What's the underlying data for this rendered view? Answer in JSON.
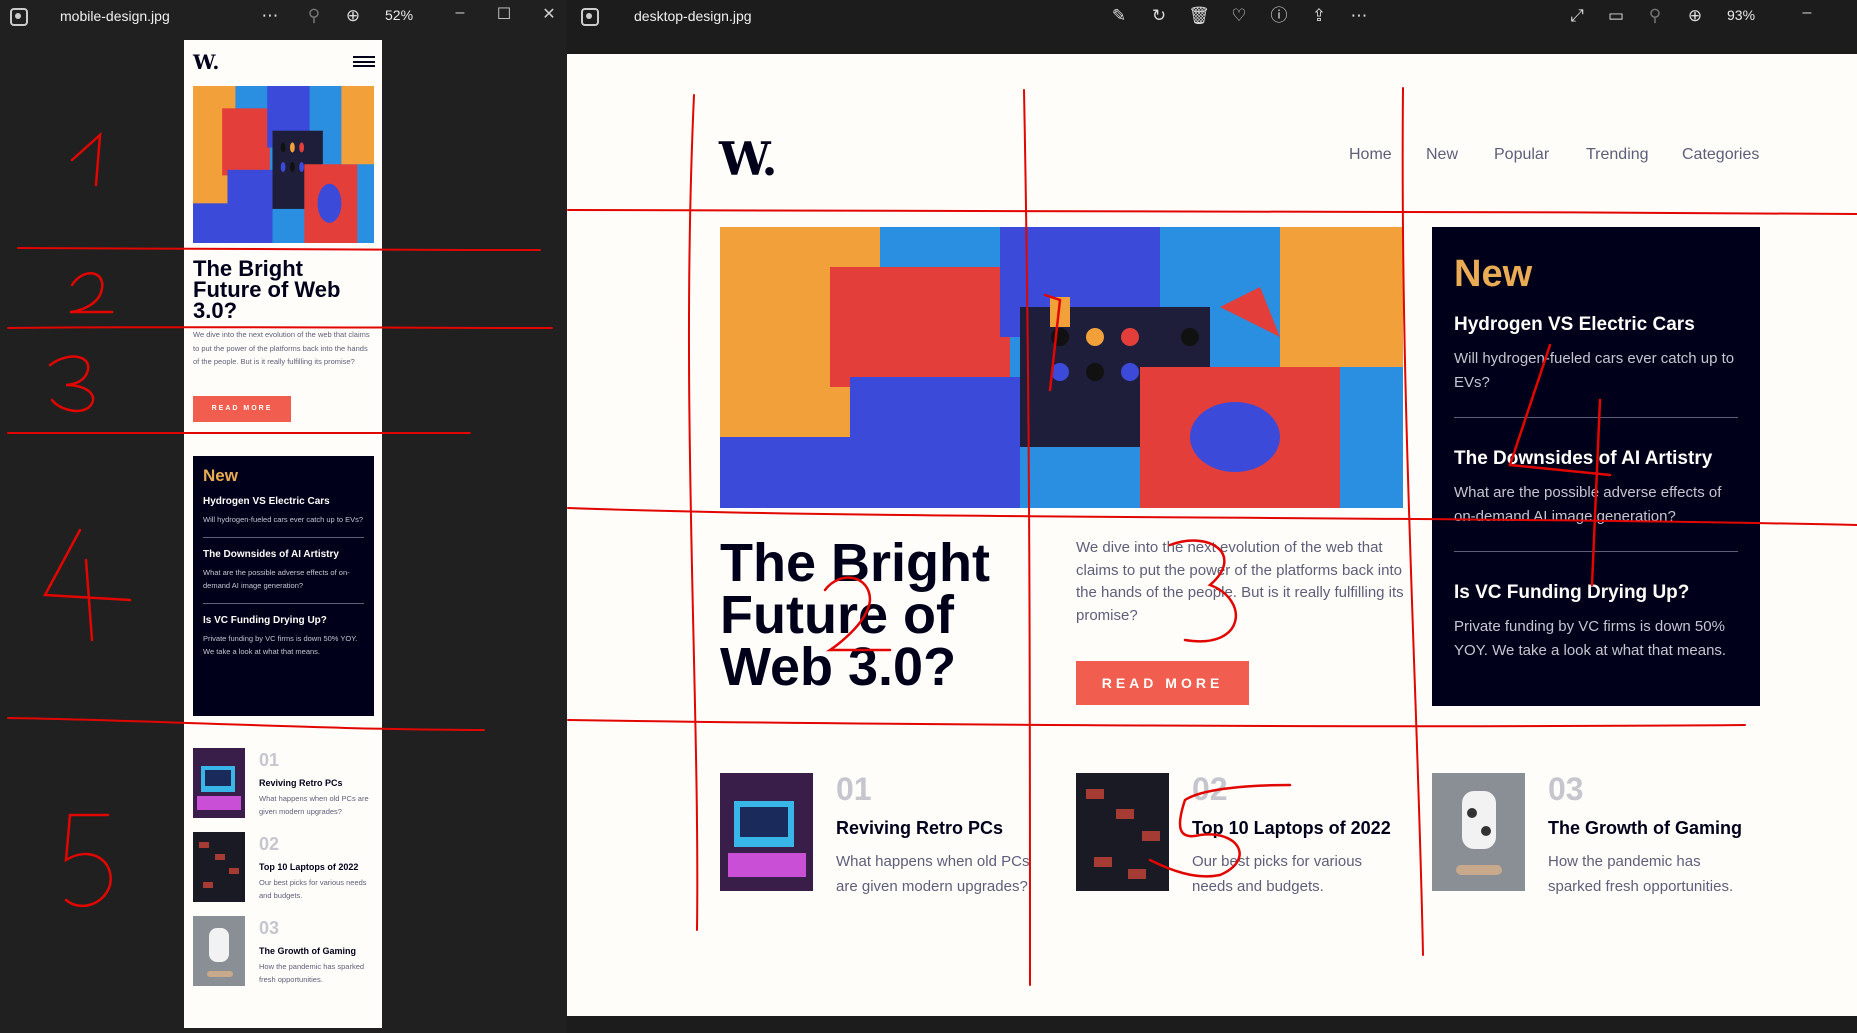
{
  "left_viewer": {
    "filename": "mobile-design.jpg",
    "zoom": "52%",
    "more_icon": "more-dots-icon",
    "zoom_out_icon": "zoom-out-icon",
    "zoom_in_icon": "zoom-in-icon"
  },
  "right_viewer": {
    "filename": "desktop-design.jpg",
    "zoom": "93%",
    "toolbar_icons": [
      "edit-image-icon",
      "rotate-icon",
      "delete-icon",
      "heart-icon",
      "info-icon",
      "share-icon",
      "more-dots-icon"
    ],
    "right_icons": [
      "fullscreen-icon",
      "actual-size-icon",
      "zoom-out-icon",
      "zoom-in-icon"
    ]
  },
  "site": {
    "logo": "W.",
    "nav": [
      "Home",
      "New",
      "Popular",
      "Trending",
      "Categories"
    ],
    "hero_title": "The Bright Future of Web 3.0?",
    "hero_desc": "We dive into the next evolution of the web that claims to put the power of the platforms back into the hands of the people. But is it really fulfilling its promise?",
    "cta": "READ MORE",
    "new_heading": "New",
    "new_items": [
      {
        "title": "Hydrogen VS Electric Cars",
        "desc": "Will hydrogen-fueled cars ever catch up to EVs?"
      },
      {
        "title": "The Downsides of AI Artistry",
        "desc": "What are the possible adverse effects of on-demand AI image generation?"
      },
      {
        "title": "Is VC Funding Drying Up?",
        "desc": "Private funding by VC firms is down 50% YOY. We take a look at what that means."
      }
    ],
    "tiles": [
      {
        "num": "01",
        "title": "Reviving Retro PCs",
        "desc": "What happens when old PCs are given modern upgrades?"
      },
      {
        "num": "02",
        "title": "Top 10 Laptops of 2022",
        "desc": "Our best picks for various needs and budgets."
      },
      {
        "num": "03",
        "title": "The Growth of Gaming",
        "desc": "How the pandemic has sparked fresh opportunities."
      }
    ]
  },
  "annotations": {
    "mobile_numbers": [
      "1",
      "2",
      "3",
      "4",
      "5"
    ],
    "desktop_numbers": [
      "1",
      "2",
      "3",
      "4",
      "5"
    ]
  },
  "colors": {
    "ink": "#e10600",
    "accent_red": "#f15e50",
    "accent_gold": "#e9ab53",
    "dark": "#00001a",
    "grey": "#5d5f79",
    "off_white": "#fffdfa"
  }
}
